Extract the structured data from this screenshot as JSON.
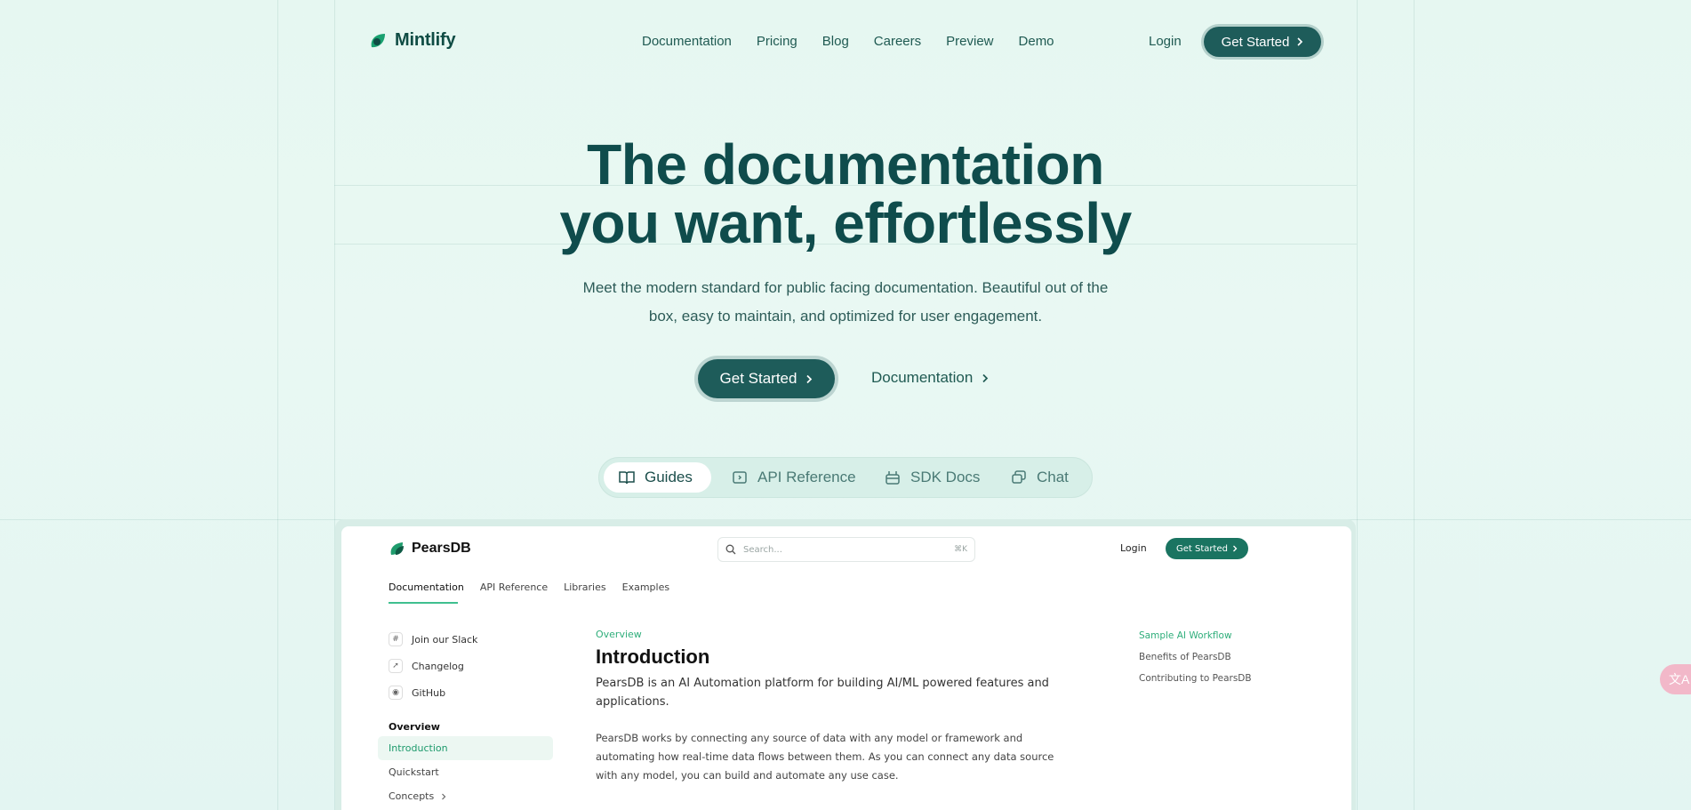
{
  "brand": {
    "name": "Mintlify"
  },
  "nav": {
    "items": [
      "Documentation",
      "Pricing",
      "Blog",
      "Careers",
      "Preview",
      "Demo"
    ],
    "login": "Login",
    "cta": "Get Started"
  },
  "hero": {
    "title_line1": "The documentation",
    "title_line2": "you want, effortlessly",
    "subtitle": "Meet the modern standard for public facing documentation. Beautiful out of the box, easy to maintain, and optimized for user engagement.",
    "primary_cta": "Get Started",
    "secondary_cta": "Documentation"
  },
  "tabs": [
    {
      "label": "Guides",
      "icon": "book-icon",
      "active": true
    },
    {
      "label": "API Reference",
      "icon": "api-icon",
      "active": false
    },
    {
      "label": "SDK Docs",
      "icon": "package-icon",
      "active": false
    },
    {
      "label": "Chat",
      "icon": "chat-icon",
      "active": false
    }
  ],
  "preview": {
    "brand": "PearsDB",
    "search_placeholder": "Search...",
    "search_shortcut": "⌘K",
    "login": "Login",
    "cta": "Get Started",
    "tabs": [
      "Documentation",
      "API Reference",
      "Libraries",
      "Examples"
    ],
    "side_links": [
      "Join our Slack",
      "Changelog",
      "GitHub"
    ],
    "section": "Overview",
    "side_items": [
      "Introduction",
      "Quickstart",
      "Concepts"
    ],
    "eyebrow": "Overview",
    "heading": "Introduction",
    "lead": "PearsDB is an AI Automation platform for building AI/ML powered features and applications.",
    "body": "PearsDB works by connecting any source of data with any model or framework and automating how real-time data flows between them. As you can connect any data source with any model, you can build and automate any use case.",
    "toc": [
      "Sample AI Workflow",
      "Benefits of PearsDB",
      "Contributing to PearsDB"
    ]
  },
  "colors": {
    "accent": "#1e5c5a",
    "brand_green": "#2fae7b",
    "background": "#e6f7f1"
  },
  "floating": {
    "label": "文A"
  }
}
